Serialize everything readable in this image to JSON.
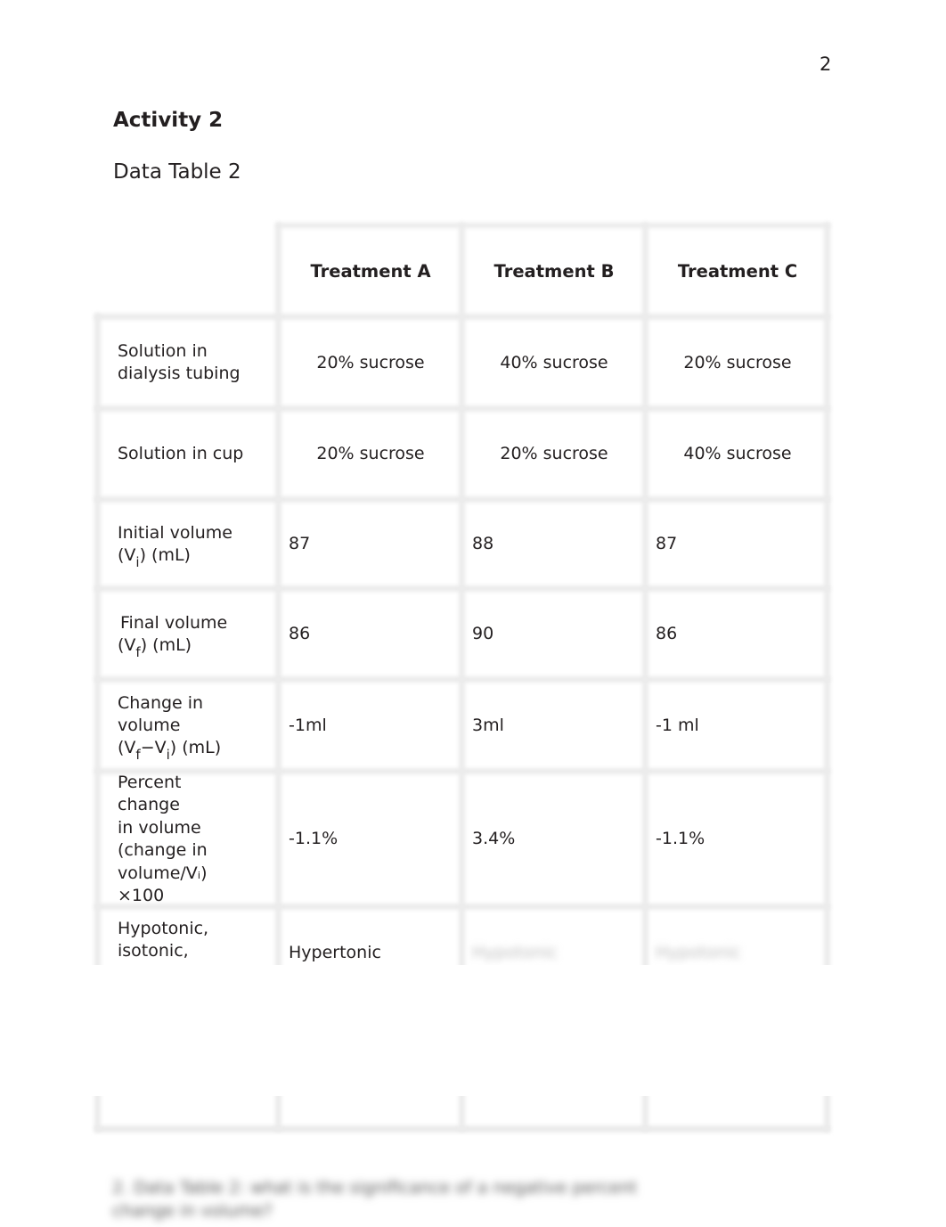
{
  "page_number": "2",
  "activity_heading": "Activity 2",
  "table_title": "Data Table 2",
  "table": {
    "columns": [
      "Treatment A",
      "Treatment B",
      "Treatment C"
    ],
    "rows": [
      {
        "label": "Solution in dialysis tubing",
        "values": [
          "20% sucrose",
          "40% sucrose",
          "20% sucrose"
        ]
      },
      {
        "label": "Solution in cup",
        "values": [
          "20% sucrose",
          "20% sucrose",
          "40% sucrose"
        ]
      },
      {
        "label_parts": [
          "Initial volume",
          "(V",
          "i",
          ") (mL)"
        ],
        "values": [
          "87",
          "88",
          "87"
        ]
      },
      {
        "label_parts": [
          "Final volume",
          "(V",
          "f",
          ") (mL)"
        ],
        "values": [
          "86",
          "90",
          "86"
        ]
      },
      {
        "label_parts": [
          "Change in",
          "volume",
          "(V",
          "f",
          "−V",
          "i",
          ") (mL)"
        ],
        "values": [
          "-1ml",
          "3ml",
          "-1 ml"
        ]
      },
      {
        "label_lines": [
          "Percent",
          "change",
          "in volume",
          "(change in",
          "volume/Vᵢ)",
          "×100"
        ],
        "values": [
          "-1.1%",
          "3.4%",
          "-1.1%"
        ]
      },
      {
        "label_lines": [
          "Hypotonic,",
          "isotonic,"
        ],
        "values": [
          "Hypertonic",
          "Hypotonic",
          "Hypotonic"
        ]
      }
    ]
  },
  "blurred_question": "2. Data Table 2: what is the significance of a negative percent change in volume?"
}
